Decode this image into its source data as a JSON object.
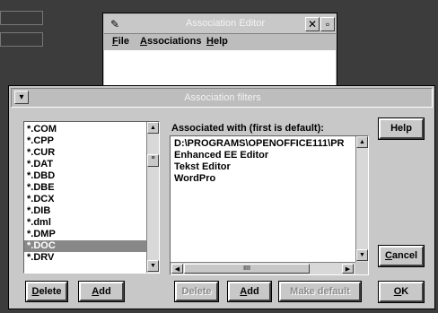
{
  "editor": {
    "title": "Association Editor",
    "sys_icon": "✎",
    "close_glyph": "✕",
    "restore_glyph": "▫",
    "menu": [
      {
        "u": "F",
        "rest": "ile"
      },
      {
        "u": "A",
        "rest": "ssociations"
      },
      {
        "u": "H",
        "rest": "elp"
      }
    ]
  },
  "dialog": {
    "title": "Association filters",
    "sys_glyph": "▾",
    "filters": [
      "*.COM",
      "*.CPP",
      "*.CUR",
      "*.DAT",
      "*.DBD",
      "*.DBE",
      "*.DCX",
      "*.DIB",
      "*.dml",
      "*.DMP",
      "*.DOC",
      "*.DRV"
    ],
    "selected_filter": "*.DOC",
    "associated_label": "Associated with (first is default):",
    "programs": [
      "D:\\PROGRAMS\\OPENOFFICE111\\PR",
      "Enhanced EE Editor",
      "Tekst Editor",
      "WordPro"
    ],
    "buttons": {
      "help": "Help",
      "cancel_u": "C",
      "cancel_rest": "ancel",
      "ok_u": "O",
      "ok_rest": "K",
      "delete_left_u": "D",
      "delete_left_rest": "elete",
      "add_left_u": "A",
      "add_left_rest": "dd",
      "delete_right": "Delete",
      "add_right_u": "A",
      "add_right_rest": "dd",
      "make_default": "Make default"
    },
    "hscroll_thumb": "IIII"
  }
}
